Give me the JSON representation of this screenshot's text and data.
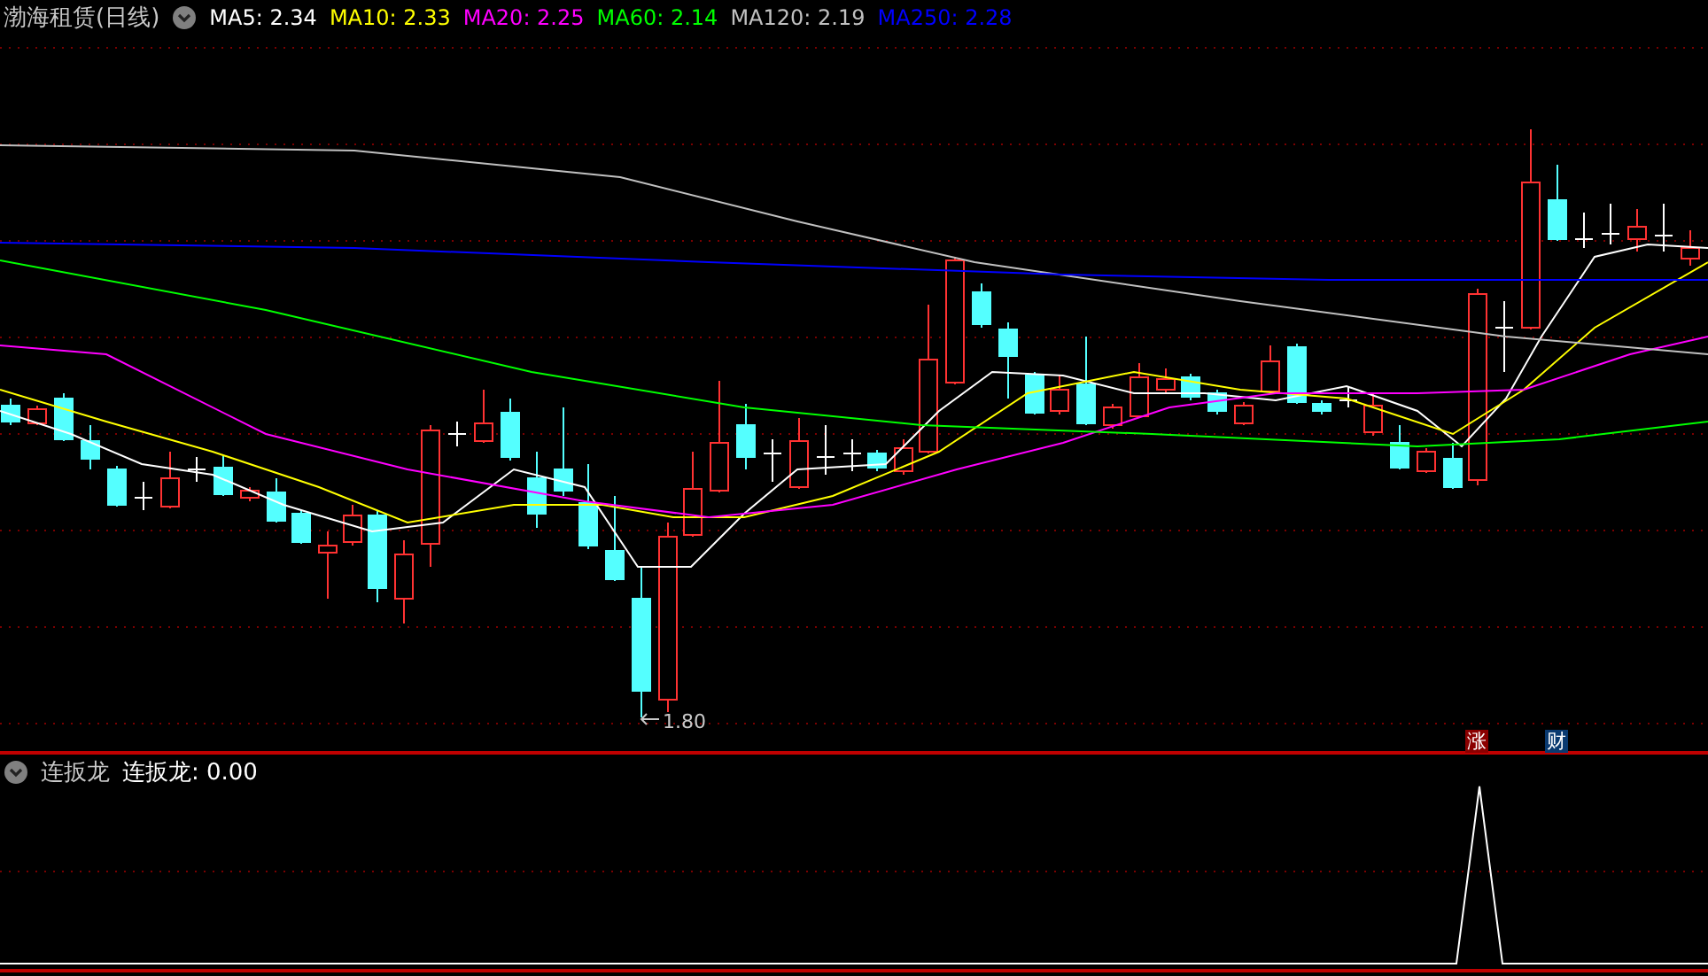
{
  "title_bar": {
    "stock": "渤海租赁(日线)"
  },
  "ma_legend": [
    {
      "label": "MA5: 2.34",
      "color": "#ffffff"
    },
    {
      "label": "MA10: 2.33",
      "color": "#ffff00"
    },
    {
      "label": "MA20: 2.25",
      "color": "#ff00ff"
    },
    {
      "label": "MA60: 2.14",
      "color": "#00ff00"
    },
    {
      "label": "MA120: 2.19",
      "color": "#c0c0c0"
    },
    {
      "label": "MA250: 2.28",
      "color": "#0000ff"
    }
  ],
  "price_chart": {
    "low_label": "1.80"
  },
  "signal_badges": [
    {
      "label": "涨",
      "kind": "rise"
    },
    {
      "label": "财",
      "kind": "finance"
    }
  ],
  "indicator": {
    "name": "连扳龙",
    "reading": "连扳龙: 0.00"
  }
}
